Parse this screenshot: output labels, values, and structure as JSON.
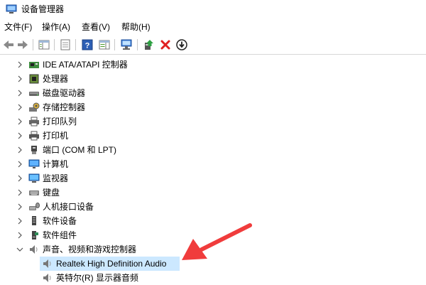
{
  "window": {
    "title": "设备管理器"
  },
  "menu": [
    {
      "label": "文件(F)"
    },
    {
      "label": "操作(A)"
    },
    {
      "label": "查看(V)"
    },
    {
      "label": "帮助(H)"
    }
  ],
  "toolbar": {
    "buttons": [
      {
        "icon": "back-arrow-icon"
      },
      {
        "icon": "forward-arrow-icon"
      },
      {
        "icon": "show-hide-console-tree-icon"
      },
      {
        "icon": "properties-icon"
      },
      {
        "icon": "help-icon"
      },
      {
        "icon": "action-pane-icon"
      },
      {
        "icon": "scan-hardware-changes-icon"
      },
      {
        "icon": "update-driver-icon"
      },
      {
        "icon": "uninstall-device-icon"
      },
      {
        "icon": "download-driver-icon"
      }
    ]
  },
  "tree": {
    "items": [
      {
        "label": "IDE ATA/ATAPI 控制器",
        "icon": "ide-controller-icon",
        "expanded": false
      },
      {
        "label": "处理器",
        "icon": "processor-icon",
        "expanded": false
      },
      {
        "label": "磁盘驱动器",
        "icon": "disk-drive-icon",
        "expanded": false
      },
      {
        "label": "存储控制器",
        "icon": "storage-controller-icon",
        "expanded": false
      },
      {
        "label": "打印队列",
        "icon": "print-queue-icon",
        "expanded": false
      },
      {
        "label": "打印机",
        "icon": "printer-icon",
        "expanded": false
      },
      {
        "label": "端口 (COM 和 LPT)",
        "icon": "port-icon",
        "expanded": false
      },
      {
        "label": "计算机",
        "icon": "computer-icon",
        "expanded": false
      },
      {
        "label": "监视器",
        "icon": "monitor-icon",
        "expanded": false
      },
      {
        "label": "键盘",
        "icon": "keyboard-icon",
        "expanded": false
      },
      {
        "label": "人机接口设备",
        "icon": "hid-icon",
        "expanded": false
      },
      {
        "label": "软件设备",
        "icon": "software-device-icon",
        "expanded": false
      },
      {
        "label": "软件组件",
        "icon": "software-component-icon",
        "expanded": false
      },
      {
        "label": "声音、视频和游戏控制器",
        "icon": "speaker-icon",
        "expanded": true
      }
    ],
    "children": [
      {
        "label": "Realtek High Definition Audio",
        "icon": "speaker-icon",
        "selected": true
      },
      {
        "label": "英特尔(R) 显示器音频",
        "icon": "speaker-icon",
        "selected": false
      }
    ]
  },
  "annotation": {
    "icon": "red-pointer-arrow",
    "color": "#f03c3c"
  },
  "colors": {
    "selection": "#cce8ff",
    "accent": "#f03c3c"
  }
}
